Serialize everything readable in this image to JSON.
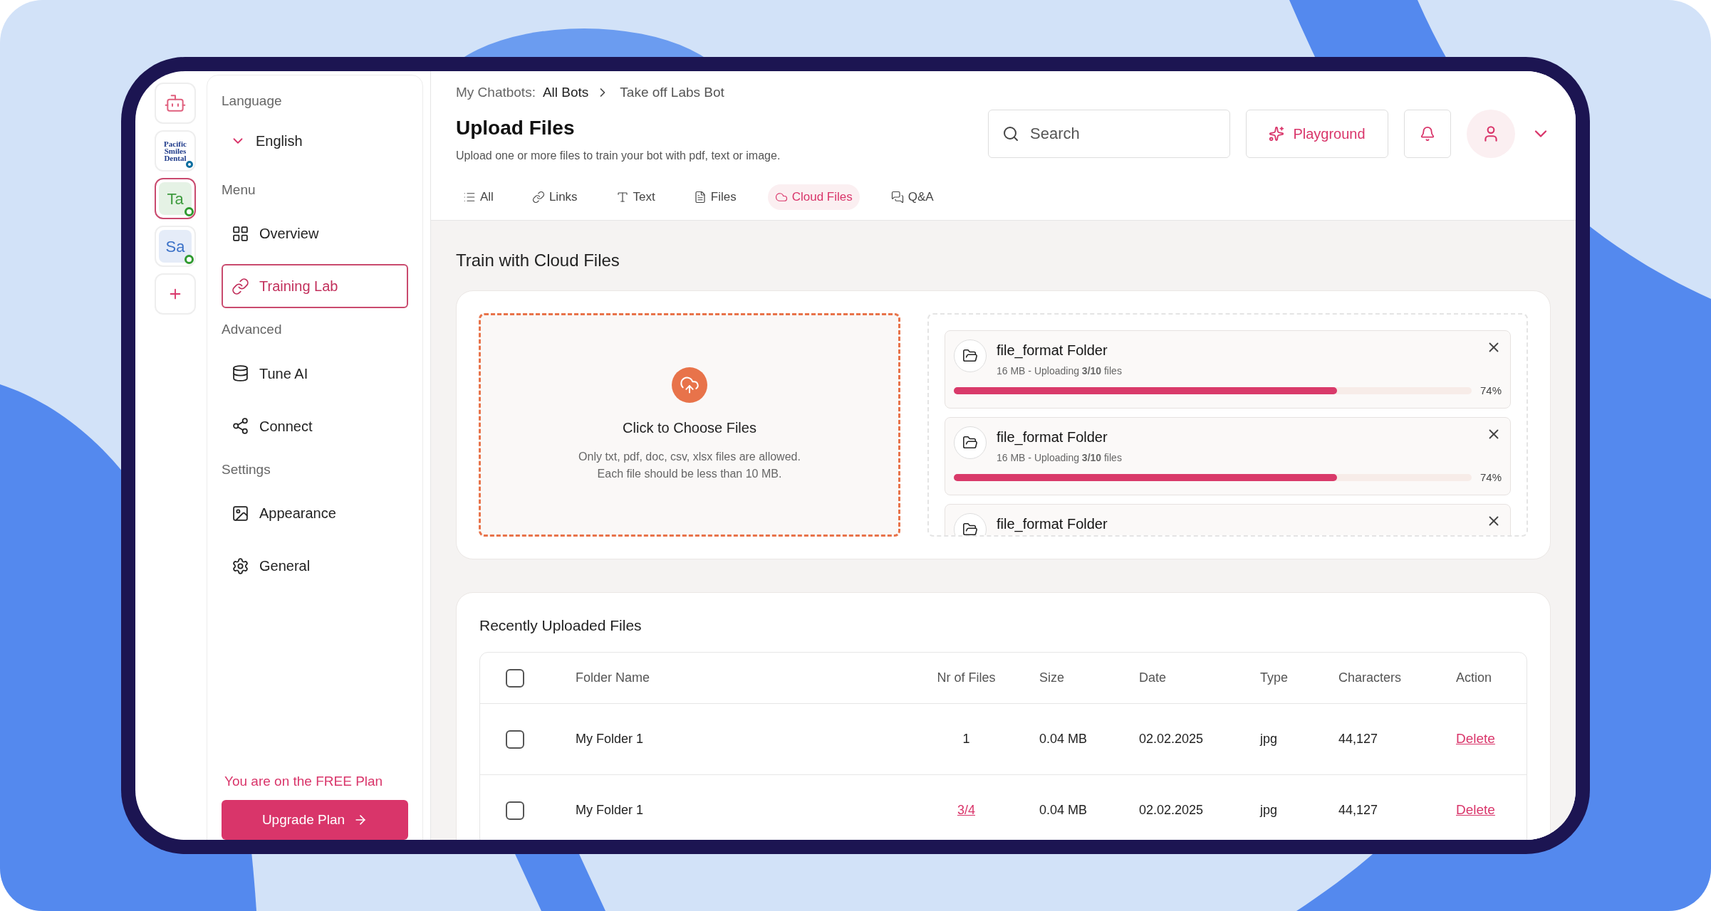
{
  "rail": [
    {
      "kind": "bot",
      "selected": false
    },
    {
      "kind": "logo",
      "text": "Pacific Smiles Dental",
      "selected": false
    },
    {
      "kind": "initials",
      "text": "Ta",
      "color": "#3e9b3e",
      "online": true,
      "selected": true
    },
    {
      "kind": "initials",
      "text": "Sa",
      "color": "#3c72c8",
      "online": true,
      "selected": false
    },
    {
      "kind": "add",
      "selected": false
    }
  ],
  "sidebar": {
    "language": {
      "label": "Language",
      "value": "English"
    },
    "sections": [
      {
        "title": "Menu",
        "items": [
          {
            "label": "Overview",
            "selected": false
          },
          {
            "label": "Training Lab",
            "selected": true
          }
        ]
      },
      {
        "title": "Advanced",
        "items": [
          {
            "label": "Tune AI",
            "selected": false
          },
          {
            "label": "Connect",
            "selected": false
          }
        ]
      },
      {
        "title": "Settings",
        "items": [
          {
            "label": "Appearance",
            "selected": false
          },
          {
            "label": "General",
            "selected": false
          }
        ]
      }
    ],
    "plan_note": "You are on the FREE Plan",
    "upgrade_button": "Upgrade Plan"
  },
  "header": {
    "breadcrumb": {
      "prefix": "My Chatbots:",
      "items": [
        "All Bots",
        "Take off Labs Bot"
      ]
    },
    "title": "Upload Files",
    "subtitle": "Upload one or more files to train your bot with pdf, text or image.",
    "search": {
      "placeholder": "Search"
    },
    "playground_button": "Playground"
  },
  "tabs": [
    {
      "label": "All",
      "selected": false
    },
    {
      "label": "Links",
      "selected": false
    },
    {
      "label": "Text",
      "selected": false
    },
    {
      "label": "Files",
      "selected": false
    },
    {
      "label": "Cloud Files",
      "selected": true
    },
    {
      "label": "Q&A",
      "selected": false
    }
  ],
  "upload": {
    "title": "Train with Cloud Files",
    "dropzone": {
      "title": "Click to Choose Files",
      "hint": [
        "Only txt, pdf, doc, csv, xlsx files are allowed.",
        "Each file should be less than 10 MB."
      ]
    },
    "uploads": [
      {
        "name": "file_format Folder",
        "meta": "16 MB - Uploading **3/10** files",
        "level": 0.74,
        "reading": "74%"
      },
      {
        "name": "file_format Folder",
        "meta": "16 MB - Uploading **3/10** files",
        "level": 0.74,
        "reading": "74%"
      },
      {
        "name": "file_format Folder"
      }
    ]
  },
  "recent": {
    "title": "Recently Uploaded Files",
    "header_checked": false,
    "columns": [
      "Folder Name",
      "Nr of Files",
      "Size",
      "Date",
      "Type",
      "Characters",
      "Action"
    ],
    "rows": [
      {
        "checked": false,
        "name": "My Folder 1",
        "files": "1",
        "files_link": false,
        "size": "0.04 MB",
        "date": "02.02.2025",
        "type": "jpg",
        "characters": "44,127",
        "action": "Delete"
      },
      {
        "checked": false,
        "name": "My Folder 1",
        "files": "3/4",
        "files_link": true,
        "size": "0.04 MB",
        "date": "02.02.2025",
        "type": "jpg",
        "characters": "44,127",
        "action": "Delete"
      }
    ]
  }
}
